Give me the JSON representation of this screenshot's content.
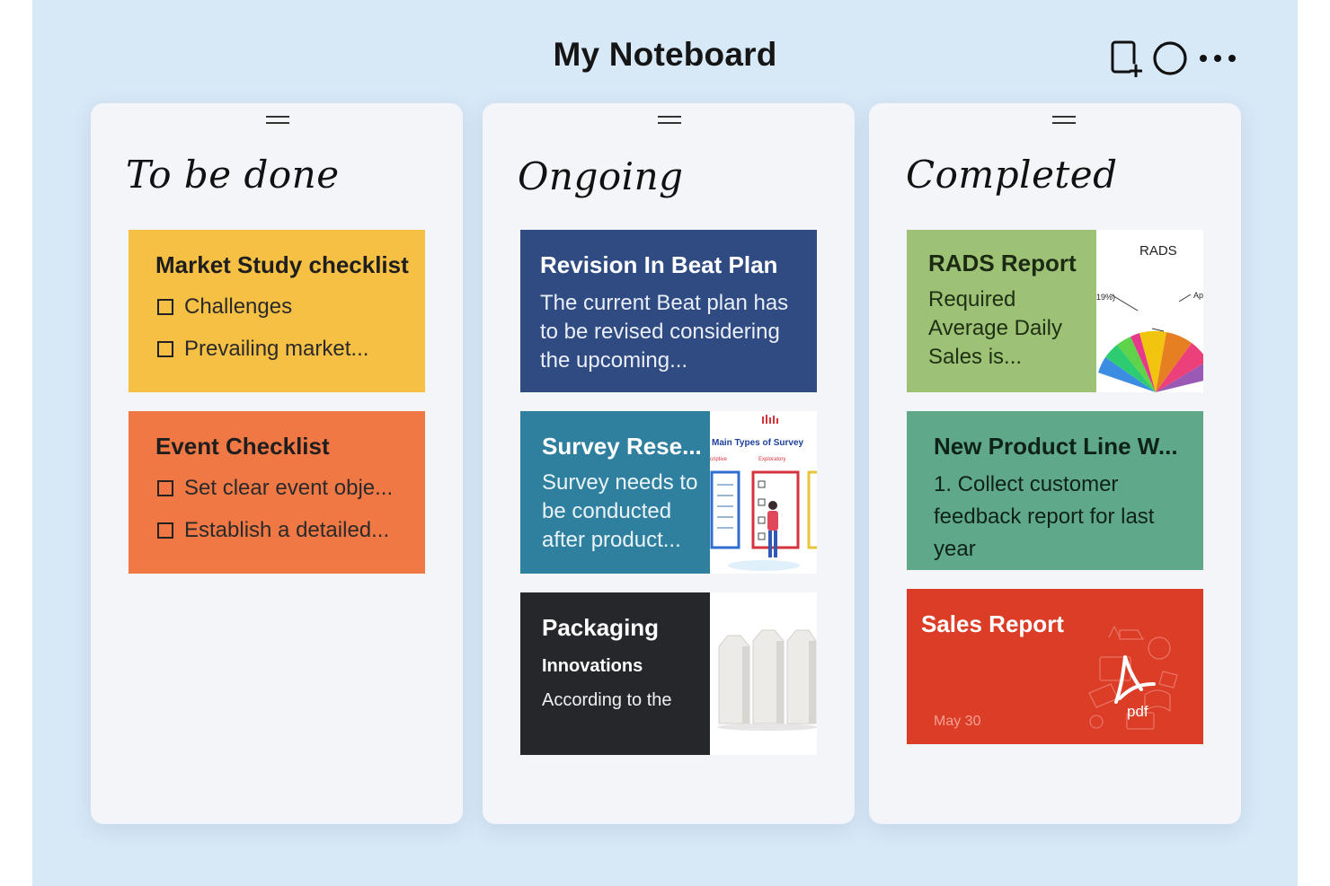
{
  "board": {
    "title": "My Noteboard"
  },
  "toolbar": {
    "icons": [
      "new-note-icon",
      "circle-icon",
      "more-icon"
    ]
  },
  "columns": [
    {
      "title": "To be done",
      "cards": [
        {
          "title": "Market Study checklist",
          "color": "#f6c044",
          "items": [
            "Challenges",
            "Prevailing market..."
          ]
        },
        {
          "title": "Event Checklist",
          "color": "#f07845",
          "items": [
            "Set clear event obje...",
            "Establish a detailed..."
          ]
        }
      ]
    },
    {
      "title": "Ongoing",
      "cards": [
        {
          "title": "Revision In Beat Plan",
          "color": "#2f4b82",
          "body": "The current Beat plan has to be revised considering the upcoming..."
        },
        {
          "title": "Survey Rese...",
          "color": "#2f809f",
          "body": "Survey needs to be conducted after product...",
          "thumb": {
            "heading": "Main Types of Survey",
            "left_label": "criptive",
            "right_label": "Exploratory"
          }
        },
        {
          "title": "Packaging",
          "color": "#26272b",
          "subtitle": "Innovations",
          "body": "According to the"
        }
      ]
    },
    {
      "title": "Completed",
      "cards": [
        {
          "title": "RADS Report",
          "color": "#9dc276",
          "body": "Required Average Daily Sales is...",
          "thumb": {
            "chart_title": "RADS",
            "left_label": "19%)",
            "right_label": "Ap"
          }
        },
        {
          "title": "New Product Line W...",
          "color": "#5fa98a",
          "body": "1. Collect customer feedback report for last year"
        },
        {
          "title": "Sales Report",
          "color": "#dc3d27",
          "date": "May 30",
          "file_label": "pdf"
        }
      ]
    }
  ]
}
